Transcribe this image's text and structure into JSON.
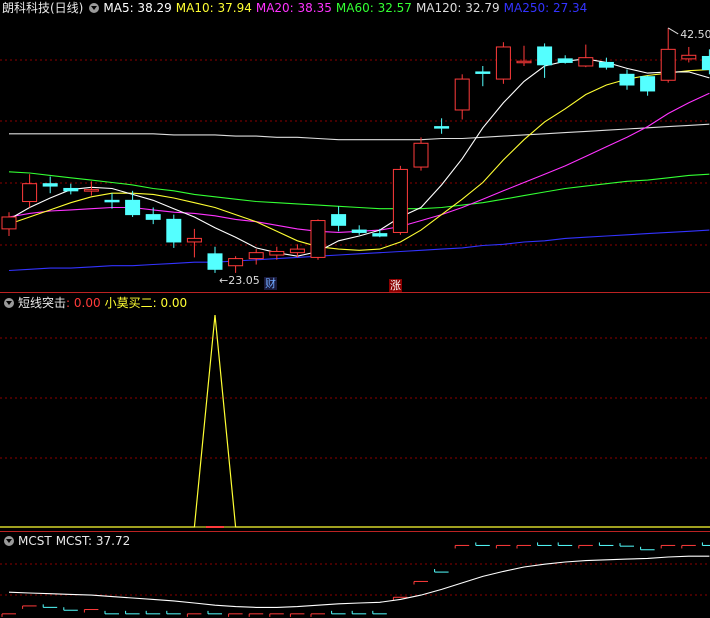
{
  "main": {
    "title": "朗科科技(日线)",
    "ma": [
      {
        "label": "MA5: 38.29",
        "color": "#ffffff"
      },
      {
        "label": "MA10: 37.94",
        "color": "#ffff33"
      },
      {
        "label": "MA20: 38.35",
        "color": "#ff33ff"
      },
      {
        "label": "MA60: 32.57",
        "color": "#33ff33"
      },
      {
        "label": "MA120: 32.79",
        "color": "#dddddd"
      },
      {
        "label": "MA250: 27.34",
        "color": "#3333ff"
      }
    ],
    "high_label": "42.50",
    "low_label": "23.05",
    "tag_cai": "财",
    "tag_zhang": "涨"
  },
  "indicator": {
    "name": "短线突击",
    "value_label": ": 0.00",
    "signal_name": "小莫买二",
    "signal_value": ": 0.00"
  },
  "mcst": {
    "name": "MCST",
    "value_label": "MCST: 37.72"
  },
  "colors": {
    "up": "#ff3b3b",
    "down": "#54ffff",
    "grid": "#8b0000",
    "border": "#b22222",
    "signal": "#ffff33"
  },
  "chart_data": {
    "type": "candlestick",
    "candles": [
      {
        "o": 25.6,
        "h": 27.0,
        "l": 25.0,
        "c": 26.6
      },
      {
        "o": 27.9,
        "h": 30.2,
        "l": 27.4,
        "c": 29.4
      },
      {
        "o": 29.4,
        "h": 30.0,
        "l": 28.6,
        "c": 29.2
      },
      {
        "o": 29.0,
        "h": 29.4,
        "l": 28.5,
        "c": 28.8
      },
      {
        "o": 28.8,
        "h": 29.6,
        "l": 28.4,
        "c": 28.9
      },
      {
        "o": 28.0,
        "h": 28.6,
        "l": 27.3,
        "c": 27.9
      },
      {
        "o": 28.0,
        "h": 28.8,
        "l": 26.6,
        "c": 26.8
      },
      {
        "o": 26.8,
        "h": 27.4,
        "l": 26.0,
        "c": 26.4
      },
      {
        "o": 26.4,
        "h": 26.8,
        "l": 24.0,
        "c": 24.5
      },
      {
        "o": 24.5,
        "h": 25.6,
        "l": 23.2,
        "c": 24.8
      },
      {
        "o": 23.5,
        "h": 24.1,
        "l": 21.9,
        "c": 22.2
      },
      {
        "o": 22.5,
        "h": 23.3,
        "l": 21.9,
        "c": 23.1
      },
      {
        "o": 23.1,
        "h": 23.9,
        "l": 22.6,
        "c": 23.6
      },
      {
        "o": 23.4,
        "h": 24.1,
        "l": 23.0,
        "c": 23.7
      },
      {
        "o": 23.6,
        "h": 24.3,
        "l": 23.2,
        "c": 23.9
      },
      {
        "o": 23.2,
        "h": 26.4,
        "l": 23.0,
        "c": 26.3
      },
      {
        "o": 26.8,
        "h": 27.5,
        "l": 25.4,
        "c": 25.9
      },
      {
        "o": 25.5,
        "h": 25.9,
        "l": 25.1,
        "c": 25.3
      },
      {
        "o": 25.2,
        "h": 25.6,
        "l": 24.9,
        "c": 25.0
      },
      {
        "o": 25.3,
        "h": 30.9,
        "l": 25.1,
        "c": 30.6
      },
      {
        "o": 30.8,
        "h": 33.3,
        "l": 30.5,
        "c": 32.8
      },
      {
        "o": 34.2,
        "h": 34.9,
        "l": 33.6,
        "c": 34.1
      },
      {
        "o": 35.6,
        "h": 38.6,
        "l": 34.8,
        "c": 38.2
      },
      {
        "o": 38.8,
        "h": 39.3,
        "l": 37.6,
        "c": 38.7
      },
      {
        "o": 38.2,
        "h": 41.3,
        "l": 37.8,
        "c": 40.9
      },
      {
        "o": 39.6,
        "h": 41.0,
        "l": 39.3,
        "c": 39.7
      },
      {
        "o": 40.9,
        "h": 41.2,
        "l": 38.3,
        "c": 39.4
      },
      {
        "o": 39.9,
        "h": 40.2,
        "l": 39.5,
        "c": 39.6
      },
      {
        "o": 39.3,
        "h": 41.1,
        "l": 39.2,
        "c": 40.0
      },
      {
        "o": 39.6,
        "h": 40.0,
        "l": 39.0,
        "c": 39.2
      },
      {
        "o": 38.6,
        "h": 39.0,
        "l": 37.3,
        "c": 37.7
      },
      {
        "o": 38.4,
        "h": 38.5,
        "l": 36.8,
        "c": 37.2
      },
      {
        "o": 38.1,
        "h": 42.5,
        "l": 37.9,
        "c": 40.7
      },
      {
        "o": 39.9,
        "h": 40.9,
        "l": 39.6,
        "c": 40.2
      },
      {
        "o": 40.1,
        "h": 40.7,
        "l": 38.6,
        "c": 39.0
      }
    ],
    "ma5": [
      26.4,
      27.4,
      28.2,
      28.9,
      29.1,
      29.0,
      28.5,
      28.0,
      27.3,
      26.6,
      25.7,
      24.9,
      24.0,
      23.6,
      23.3,
      23.7,
      24.6,
      25.0,
      25.5,
      26.6,
      27.4,
      29.3,
      31.5,
      34.1,
      36.2,
      38.0,
      39.3,
      39.7,
      39.9,
      39.6,
      39.1,
      38.7,
      38.8,
      38.8,
      38.3
    ],
    "ma10": [
      26.0,
      26.6,
      27.2,
      27.8,
      28.3,
      28.6,
      28.6,
      28.5,
      28.2,
      27.8,
      27.4,
      26.8,
      26.2,
      25.4,
      24.6,
      24.1,
      23.9,
      23.8,
      23.9,
      24.5,
      25.5,
      26.8,
      28.1,
      29.5,
      31.4,
      33.1,
      34.6,
      35.7,
      36.9,
      37.7,
      38.2,
      38.5,
      38.7,
      38.9,
      39.0
    ],
    "ma20": [
      26.6,
      26.9,
      27.1,
      27.2,
      27.3,
      27.4,
      27.4,
      27.2,
      27.0,
      26.9,
      26.7,
      26.4,
      26.2,
      25.9,
      25.6,
      25.4,
      25.3,
      25.4,
      25.5,
      25.8,
      26.3,
      26.8,
      27.4,
      28.1,
      28.8,
      29.5,
      30.2,
      30.9,
      31.7,
      32.5,
      33.3,
      34.2,
      35.3,
      36.2,
      37.0
    ],
    "ma60": [
      30.4,
      30.3,
      30.1,
      29.9,
      29.7,
      29.5,
      29.3,
      29.0,
      28.8,
      28.5,
      28.3,
      28.1,
      27.9,
      27.8,
      27.7,
      27.6,
      27.5,
      27.4,
      27.3,
      27.3,
      27.3,
      27.4,
      27.6,
      27.8,
      28.1,
      28.4,
      28.7,
      29.0,
      29.2,
      29.4,
      29.6,
      29.7,
      29.9,
      30.1,
      30.2
    ],
    "ma120": [
      33.6,
      33.6,
      33.6,
      33.6,
      33.6,
      33.6,
      33.6,
      33.6,
      33.5,
      33.5,
      33.5,
      33.4,
      33.4,
      33.3,
      33.3,
      33.2,
      33.1,
      33.1,
      33.1,
      33.1,
      33.1,
      33.2,
      33.2,
      33.3,
      33.4,
      33.5,
      33.6,
      33.7,
      33.8,
      33.9,
      34.0,
      34.1,
      34.2,
      34.3,
      34.4
    ],
    "ma250": [
      22.1,
      22.2,
      22.3,
      22.3,
      22.4,
      22.5,
      22.5,
      22.6,
      22.7,
      22.8,
      22.8,
      22.9,
      23.0,
      23.1,
      23.2,
      23.3,
      23.4,
      23.5,
      23.6,
      23.7,
      23.8,
      23.9,
      24.0,
      24.2,
      24.3,
      24.5,
      24.6,
      24.8,
      24.9,
      25.0,
      25.1,
      25.2,
      25.3,
      25.4,
      25.5
    ],
    "ylim": [
      21.3,
      43.0
    ],
    "signal": [
      0,
      0,
      0,
      0,
      0,
      0,
      0,
      0,
      0,
      0,
      1,
      0,
      0,
      0,
      0,
      0,
      0,
      0,
      0,
      0,
      0,
      0,
      0,
      0,
      0,
      0,
      0,
      0,
      0,
      0,
      0,
      0,
      0,
      0,
      0
    ],
    "signal_ylim": [
      0,
      1
    ],
    "mcst_line": [
      26.1,
      26.0,
      25.9,
      25.8,
      25.7,
      25.5,
      25.3,
      25.1,
      24.9,
      24.6,
      24.3,
      24.1,
      24.0,
      24.0,
      24.1,
      24.3,
      24.5,
      24.6,
      24.7,
      25.1,
      25.7,
      26.5,
      27.4,
      28.3,
      29.0,
      29.6,
      30.0,
      30.3,
      30.5,
      30.6,
      30.7,
      30.8,
      31.0,
      31.1,
      31.1
    ],
    "mcst_ylim": [
      22.8,
      32.8
    ],
    "high_index": 32,
    "low_index": 10
  }
}
